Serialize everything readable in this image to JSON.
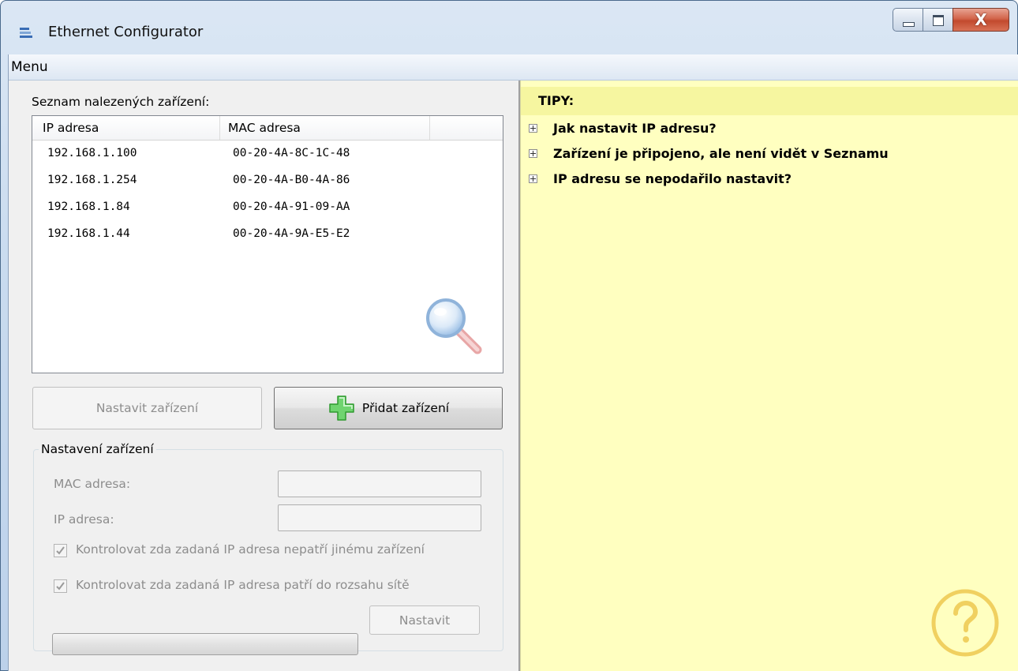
{
  "window": {
    "title": "Ethernet Configurator",
    "close_glyph": "X"
  },
  "menu": {
    "items": [
      "Menu"
    ]
  },
  "device_list": {
    "label": "Seznam nalezených zařízení:",
    "columns": [
      "IP adresa",
      "MAC adresa"
    ],
    "rows": [
      {
        "ip": "192.168.1.100",
        "mac": "00-20-4A-8C-1C-48"
      },
      {
        "ip": "192.168.1.254",
        "mac": "00-20-4A-B0-4A-86"
      },
      {
        "ip": "192.168.1.84",
        "mac": "00-20-4A-91-09-AA"
      },
      {
        "ip": "192.168.1.44",
        "mac": "00-20-4A-9A-E5-E2"
      }
    ]
  },
  "buttons": {
    "configure_device": "Nastavit zařízení",
    "add_device": "Přidat zařízení",
    "apply": "Nastavit"
  },
  "settings": {
    "group_title": "Nastavení zařízení",
    "mac_label": "MAC adresa:",
    "mac_value": "",
    "ip_label": "IP adresa:",
    "ip_value": "",
    "check_not_used": {
      "label": "Kontrolovat zda zadaná IP adresa nepatří jinému zařízení",
      "checked": true
    },
    "check_in_range": {
      "label": "Kontrolovat zda zadaná IP adresa patří do rozsahu sítě",
      "checked": true
    },
    "progress": 0
  },
  "tips": {
    "title": "TIPY:",
    "items": [
      "Jak nastavit IP adresu?",
      "Zařízení je připojeno, ale není vidět v Seznamu",
      "IP adresu se nepodařilo nastavit?"
    ]
  },
  "icons": {
    "app": "network-icon",
    "search": "magnifier-icon",
    "add": "plus-icon",
    "help": "question-mark-icon"
  },
  "colors": {
    "tips_background": "#ffffc0",
    "add_icon": "#4cc64c",
    "help_icon": "#f0d060"
  }
}
